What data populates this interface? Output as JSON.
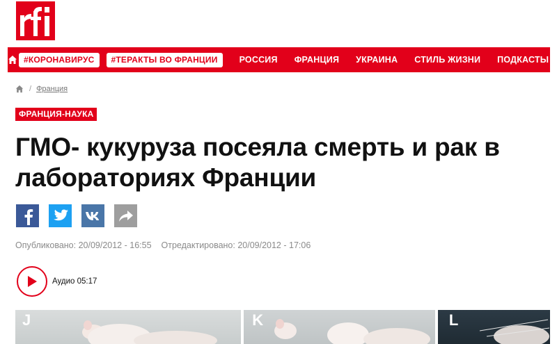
{
  "header": {
    "logo_text": "rfi",
    "brand_color": "#e2001a"
  },
  "nav": {
    "home_icon": "home-icon",
    "tags": [
      "#КОРОНАВИРУС",
      "#ТЕРАКТЫ ВО ФРАНЦИИ"
    ],
    "links": [
      "РОССИЯ",
      "ФРАНЦИЯ",
      "УКРАИНА",
      "СТИЛЬ ЖИЗНИ",
      "ПОДКАСТЫ"
    ]
  },
  "breadcrumb": {
    "home_icon": "home-icon",
    "separator": "/",
    "section": "Франция"
  },
  "article": {
    "category": "ФРАНЦИЯ-НАУКА",
    "title": "ГМО- кукуруза посеяла смерть и рак в лабораториях Франции",
    "published": "Опубликовано: 20/09/2012 - 16:55",
    "edited": "Отредактировано: 20/09/2012 - 17:06",
    "audio_label": "Аудио 05:17"
  },
  "share": {
    "icons": [
      "facebook-icon",
      "twitter-icon",
      "vk-icon",
      "share-icon"
    ]
  },
  "photo": {
    "panel_letters": [
      "J",
      "K",
      "L"
    ]
  }
}
